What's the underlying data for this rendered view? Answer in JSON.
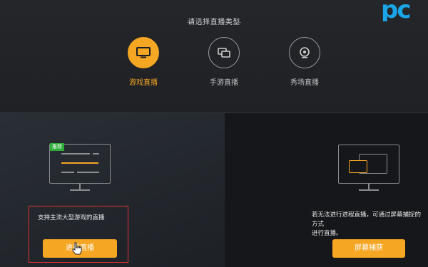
{
  "header": {
    "title": "请选择直播类型",
    "logo_text": "pc"
  },
  "live_types": [
    {
      "label": "游戏直播",
      "icon": "monitor-icon",
      "active": true
    },
    {
      "label": "手游直播",
      "icon": "mobile-screens-icon",
      "active": false
    },
    {
      "label": "秀场直播",
      "icon": "webcam-icon",
      "active": false
    }
  ],
  "panels": {
    "left": {
      "badge": "推荐",
      "description": "支持主流大型游戏的直播",
      "button_label": "进程直播"
    },
    "right": {
      "description_line1": "若无法进行进程直播，可通过屏幕捕捉的方式",
      "description_line2": "进行直播。",
      "button_label": "屏幕捕获"
    }
  },
  "colors": {
    "accent": "#f5a623",
    "badge": "#2fae3c",
    "highlight": "#e03030",
    "logo": "#1aa5e6"
  }
}
